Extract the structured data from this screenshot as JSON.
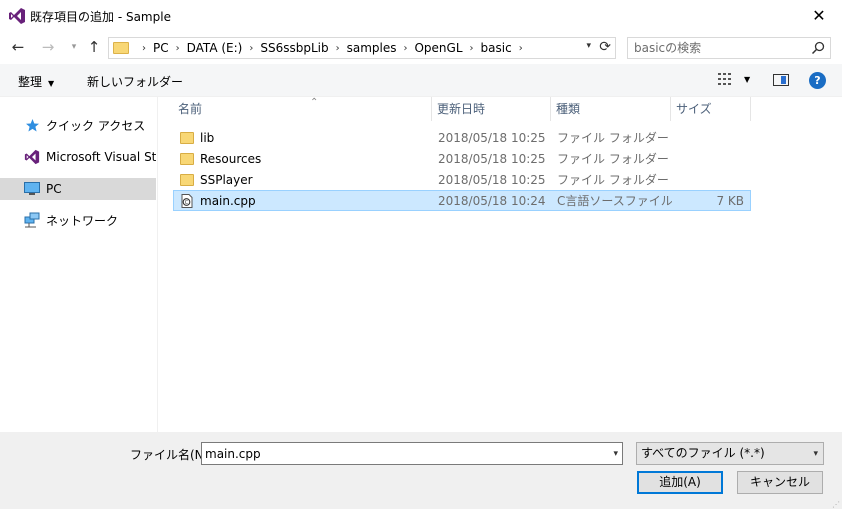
{
  "window": {
    "title": "既存項目の追加 - Sample",
    "close_glyph": "✕"
  },
  "nav": {
    "breadcrumbs": [
      "PC",
      "DATA (E:)",
      "SS6ssbpLib",
      "samples",
      "OpenGL",
      "basic"
    ],
    "search_placeholder": "basicの検索"
  },
  "toolbar": {
    "organize": "整理",
    "new_folder": "新しいフォルダー"
  },
  "sidebar": {
    "items": [
      {
        "label": "クイック アクセス",
        "icon": "star-icon"
      },
      {
        "label": "Microsoft Visual Studio",
        "icon": "visual-studio-icon"
      },
      {
        "label": "PC",
        "icon": "computer-icon",
        "selected": true
      },
      {
        "label": "ネットワーク",
        "icon": "network-icon"
      }
    ]
  },
  "columns": {
    "name": "名前",
    "date": "更新日時",
    "type": "種類",
    "size": "サイズ"
  },
  "files": [
    {
      "name": "lib",
      "date": "2018/05/18 10:25",
      "type": "ファイル フォルダー",
      "size": "",
      "icon": "folder-icon"
    },
    {
      "name": "Resources",
      "date": "2018/05/18 10:25",
      "type": "ファイル フォルダー",
      "size": "",
      "icon": "folder-icon"
    },
    {
      "name": "SSPlayer",
      "date": "2018/05/18 10:25",
      "type": "ファイル フォルダー",
      "size": "",
      "icon": "folder-icon"
    },
    {
      "name": "main.cpp",
      "date": "2018/05/18 10:24",
      "type": "C言語ソースファイル",
      "size": "7 KB",
      "icon": "cpp-file-icon",
      "selected": true
    }
  ],
  "footer": {
    "filename_label": "ファイル名(N):",
    "filename_value": "main.cpp",
    "filetype_value": "すべてのファイル (*.*)",
    "ok_label": "追加(A)",
    "cancel_label": "キャンセル"
  },
  "colors": {
    "accent": "#0078d7",
    "selection_bg": "#cce8ff",
    "selection_border": "#99d1ff",
    "vs_purple": "#68217a",
    "folder_yellow": "#f8d775"
  }
}
